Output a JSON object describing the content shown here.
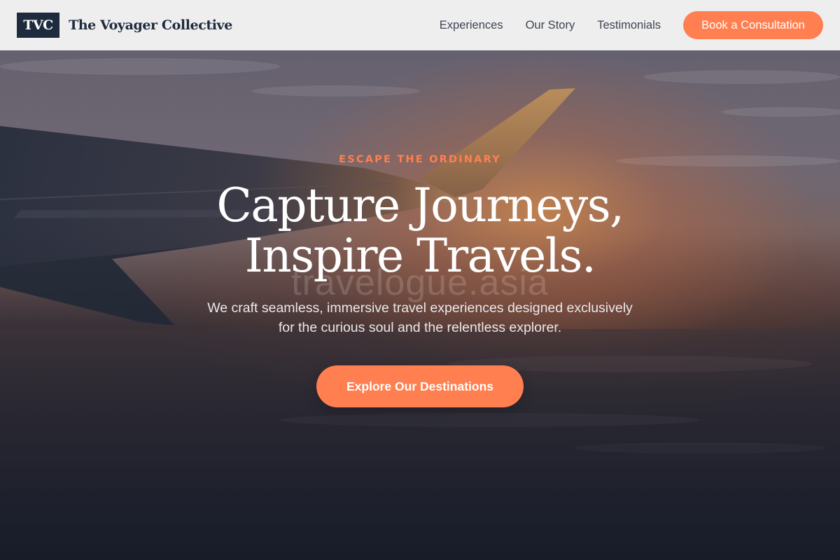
{
  "brand": {
    "logo_text": "TVC",
    "name": "The Voyager Collective"
  },
  "nav": {
    "links": [
      {
        "label": "Experiences"
      },
      {
        "label": "Our Story"
      },
      {
        "label": "Testimonials"
      }
    ],
    "cta_label": "Book a Consultation"
  },
  "hero": {
    "eyebrow": "ESCAPE THE ORDINARY",
    "headline_line1": "Capture Journeys,",
    "headline_line2": "Inspire Travels.",
    "watermark": "travelogue.asia",
    "subtitle_line1": "We craft seamless, immersive travel experiences designed exclusively",
    "subtitle_line2": "for the curious soul and the relentless explorer.",
    "cta_label": "Explore Our Destinations",
    "background_image": "airplane-wing-sunset-photo"
  },
  "colors": {
    "accent": "#ff7f50",
    "brand_navy": "#1e2a3e",
    "nav_bg": "#f3f3f3"
  }
}
